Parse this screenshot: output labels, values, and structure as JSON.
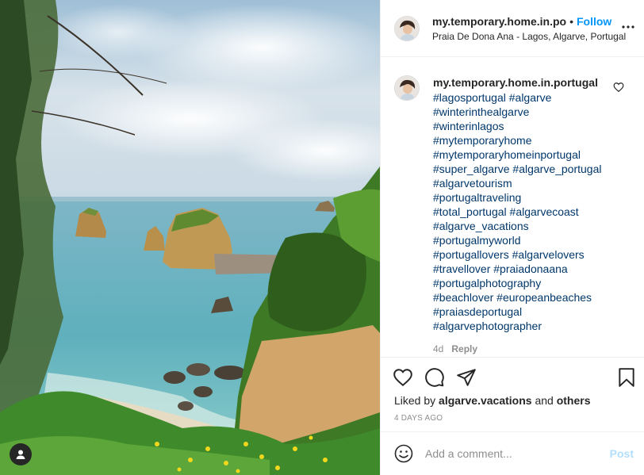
{
  "post": {
    "username": "my.temporary.home.in.po",
    "separator": "•",
    "follow_label": "Follow",
    "location": "Praia De Dona Ana - Lagos, Algarve, Portugal",
    "more_icon": "more-horizontal-icon"
  },
  "caption": {
    "username": "my.temporary.home.in.portugal",
    "hashtag_lines": [
      [
        "#lagosportugal",
        "#algarve"
      ],
      [
        "#winterinthealgarve"
      ],
      [
        "#winterinlagos"
      ],
      [
        "#mytemporaryhome"
      ],
      [
        "#mytemporaryhomeinportugal"
      ],
      [
        "#super_algarve",
        "#algarve_portugal"
      ],
      [
        "#algarvetourism"
      ],
      [
        "#portugaltraveling"
      ],
      [
        "#total_portugal",
        "#algarvecoast"
      ],
      [
        "#algarve_vacations"
      ],
      [
        "#portugalmyworld"
      ],
      [
        "#portugallovers",
        "#algarvelovers"
      ],
      [
        "#travellover",
        "#praiadonaana"
      ],
      [
        "#portugalphotography"
      ],
      [
        "#beachlover",
        "#europeanbeaches"
      ],
      [
        "#praiasdeportugal"
      ],
      [
        "#algarvephotographer"
      ]
    ],
    "age": "4d",
    "reply_label": "Reply"
  },
  "actions": {
    "icons": [
      "heart-icon",
      "comment-icon",
      "share-icon",
      "bookmark-icon"
    ],
    "liked_prefix": "Liked by",
    "liked_user": "algarve.vacations",
    "liked_and": "and",
    "liked_others": "others",
    "timestamp": "4 DAYS AGO"
  },
  "comment_box": {
    "placeholder": "Add a comment...",
    "post_label": "Post"
  },
  "colors": {
    "link_blue": "#0095f6",
    "hashtag": "#00376b",
    "muted": "#8e8e8e",
    "post_disabled": "#b2dffc"
  }
}
